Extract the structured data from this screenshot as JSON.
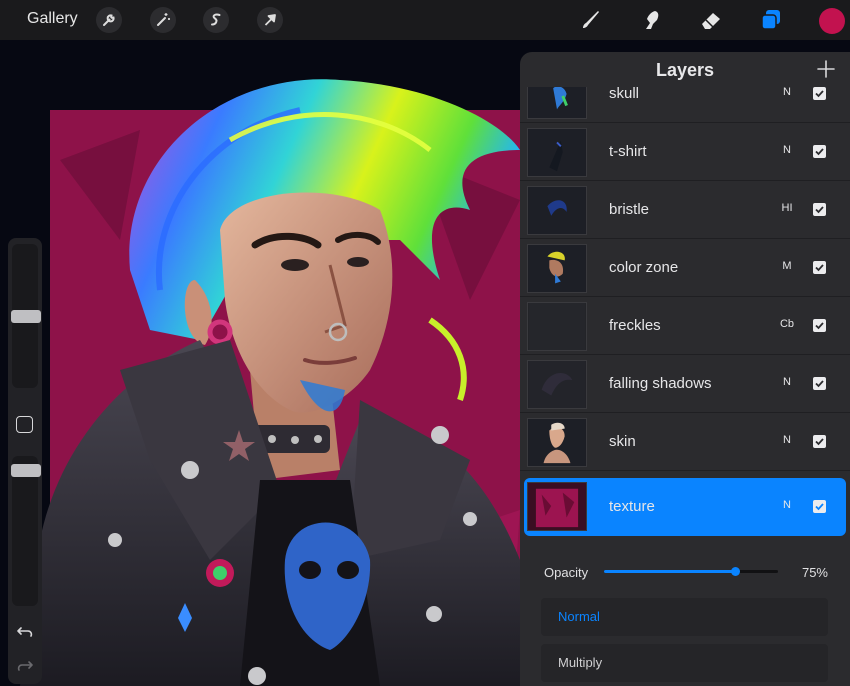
{
  "toolbar": {
    "gallery_label": "Gallery",
    "left_tools": [
      {
        "name": "wrench-icon",
        "label": "Actions"
      },
      {
        "name": "magic-wand-icon",
        "label": "Adjustments"
      },
      {
        "name": "selection-icon",
        "label": "Selection"
      },
      {
        "name": "arrow-cursor-icon",
        "label": "Transform"
      }
    ],
    "right_tools": [
      {
        "name": "brush-icon",
        "label": "Paint"
      },
      {
        "name": "smudge-icon",
        "label": "Smudge"
      },
      {
        "name": "eraser-icon",
        "label": "Erase"
      },
      {
        "name": "layers-icon",
        "label": "Layers",
        "active": true
      }
    ],
    "current_color": "#c2124f",
    "active_color": "#0a84ff"
  },
  "sidebar": {
    "brush_size_level": 0.5,
    "opacity_level": 0.06,
    "icons": [
      "modify-square-icon",
      "undo-icon",
      "redo-icon"
    ]
  },
  "layers_panel": {
    "title": "Layers",
    "add_icon": "plus-icon",
    "layers": [
      {
        "name": "skull",
        "blend": "N",
        "visible": true,
        "selected": false
      },
      {
        "name": "t-shirt",
        "blend": "N",
        "visible": true,
        "selected": false
      },
      {
        "name": "bristle",
        "blend": "HI",
        "visible": true,
        "selected": false
      },
      {
        "name": "color zone",
        "blend": "M",
        "visible": true,
        "selected": false
      },
      {
        "name": "freckles",
        "blend": "Cb",
        "visible": true,
        "selected": false
      },
      {
        "name": "falling shadows",
        "blend": "N",
        "visible": true,
        "selected": false
      },
      {
        "name": "skin",
        "blend": "N",
        "visible": true,
        "selected": false
      },
      {
        "name": "texture",
        "blend": "N",
        "visible": true,
        "selected": true
      }
    ],
    "opacity": {
      "label": "Opacity",
      "value": 75,
      "value_label": "75%"
    },
    "blend_modes": [
      {
        "label": "Normal",
        "active": true
      },
      {
        "label": "Multiply",
        "active": false
      }
    ]
  }
}
